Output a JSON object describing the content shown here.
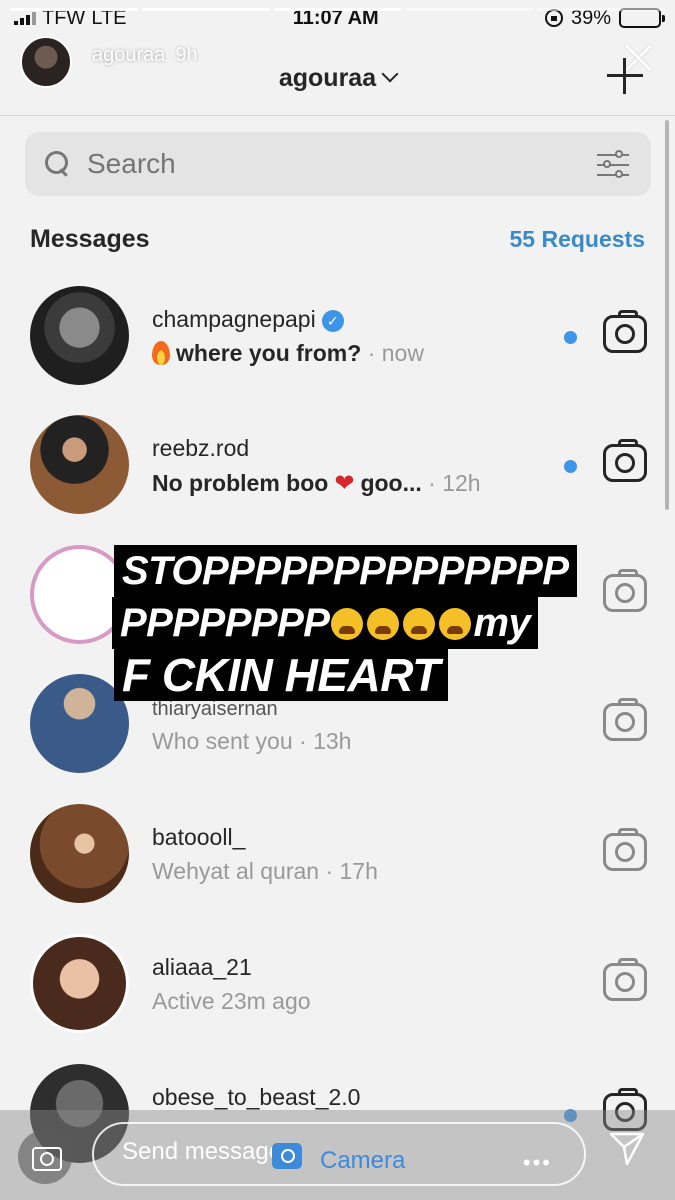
{
  "status": {
    "carrier": "TFW",
    "network": "LTE",
    "time": "11:07 AM",
    "battery": "39%"
  },
  "story": {
    "username": "agouraa",
    "age": "9h"
  },
  "header": {
    "account": "agouraa"
  },
  "search": {
    "placeholder": "Search"
  },
  "messages": {
    "title": "Messages",
    "requests": "55 Requests"
  },
  "threads": [
    {
      "username": "champagnepapi",
      "verified": true,
      "preview": "where you from?",
      "time": "· now",
      "unread": true
    },
    {
      "username": "reebz.rod",
      "preview": "No problem boo",
      "preview_tail": "goo...",
      "time": "· 12h",
      "unread": true
    },
    {
      "username": "thiaryaisernan",
      "preview": "Who sent you",
      "time": "· 13h",
      "unread": false
    },
    {
      "username": "batoooll_",
      "preview": "Wehyat al quran",
      "time": "· 17h",
      "unread": false
    },
    {
      "username": "aliaaa_21",
      "preview": "Active 23m ago",
      "time": "",
      "unread": false
    },
    {
      "username": "obese_to_beast_2.0",
      "preview": "",
      "time": "",
      "unread": true
    }
  ],
  "overlay": {
    "line1": "STOPPPPPPPPPPPPPP",
    "line2": "PPPPPPPP",
    "line2_tail": "my",
    "line3": "F  CKIN HEART"
  },
  "reply": {
    "placeholder": "Send message",
    "more": "•••",
    "camera_label": "Camera"
  },
  "colors": {
    "accent": "#3d95e9",
    "link": "#3a8ac9",
    "unread_dot": "#3d95e9",
    "heart": "#d9262e"
  },
  "icons": [
    "search-icon",
    "filter-icon",
    "camera-icon",
    "plus-icon",
    "close-icon",
    "send-icon",
    "verified-badge-icon",
    "fire-icon",
    "heart-icon",
    "weary-face-icon"
  ]
}
